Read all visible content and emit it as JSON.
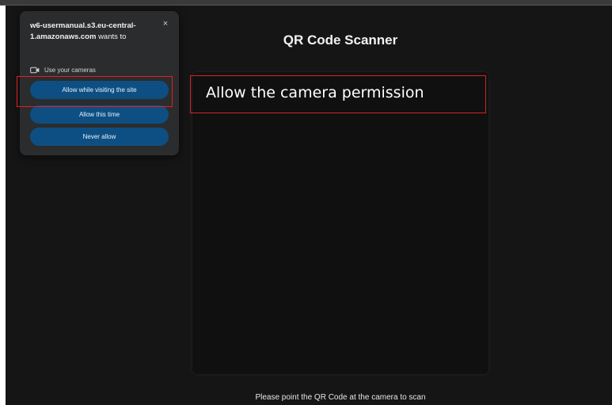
{
  "page": {
    "title": "QR Code Scanner",
    "instruction": "Please point the QR Code at the camera to scan"
  },
  "permission_popup": {
    "site": "w6-usermanual.s3.eu-central-1.amazonaws.com",
    "wants_text": "wants to",
    "permission_icon": "camera-icon",
    "permission_label": "Use your cameras",
    "close_icon": "close-icon",
    "close_symbol": "×",
    "buttons": {
      "allow_while_visiting": "Allow while visiting the site",
      "allow_this_time": "Allow this time",
      "never_allow": "Never allow"
    }
  },
  "annotation": {
    "text": "Allow the camera permission",
    "color": "#d2232a"
  },
  "colors": {
    "background": "#151515",
    "popup": "#2b2c2e",
    "button": "#0d4f82"
  }
}
